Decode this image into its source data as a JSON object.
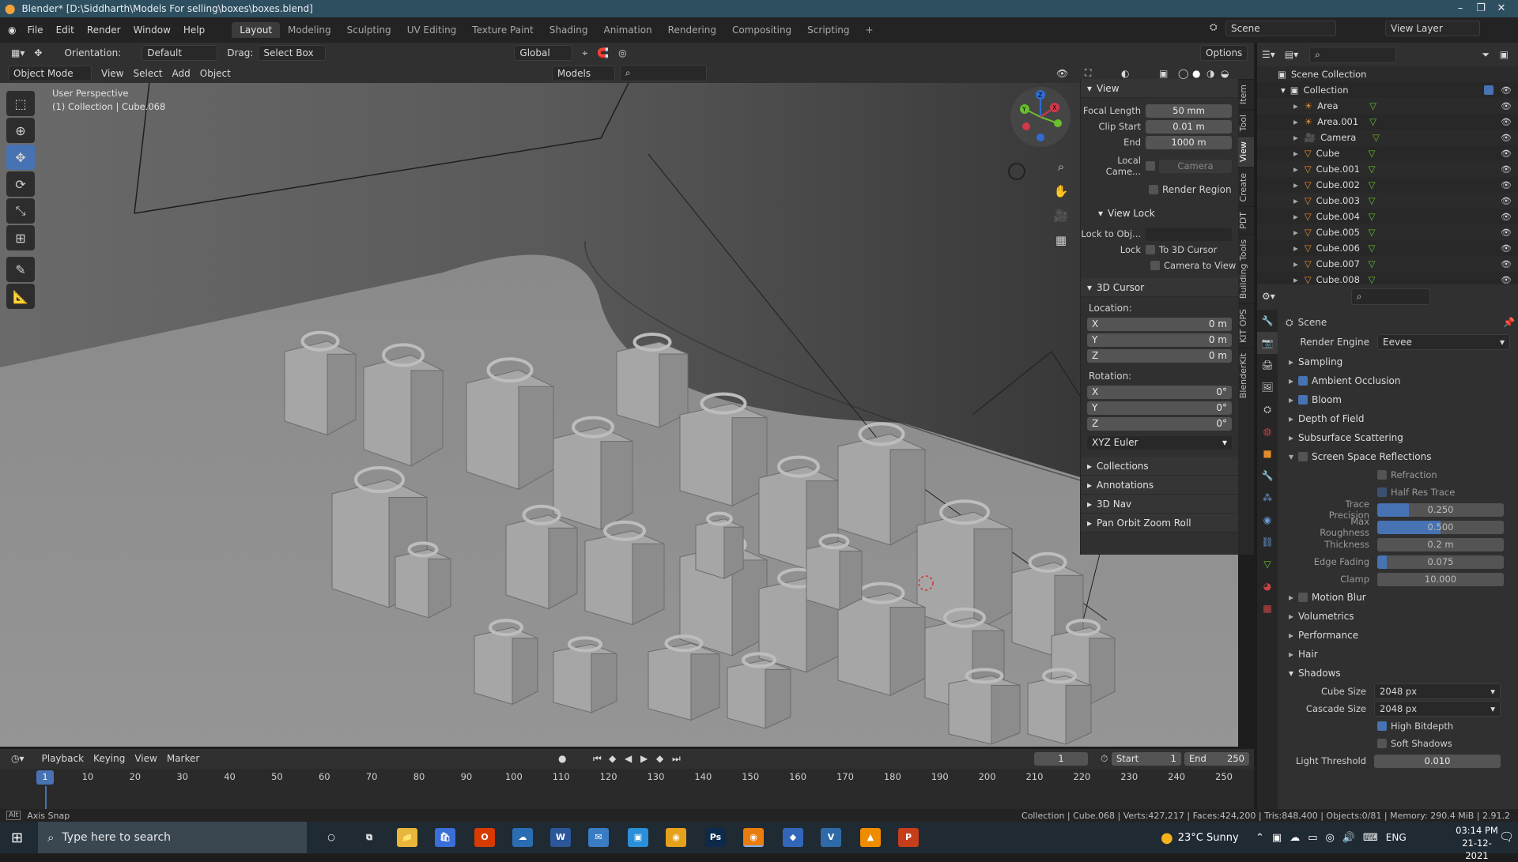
{
  "window": {
    "title": "Blender* [D:\\Siddharth\\Models For selling\\boxes\\boxes.blend]"
  },
  "menubar": {
    "items": [
      "File",
      "Edit",
      "Render",
      "Window",
      "Help"
    ]
  },
  "workspaces": [
    "Layout",
    "Modeling",
    "Sculpting",
    "UV Editing",
    "Texture Paint",
    "Shading",
    "Animation",
    "Rendering",
    "Compositing",
    "Scripting"
  ],
  "scene_field": "Scene",
  "viewlayer_field": "View Layer",
  "header": {
    "orientation_label": "Orientation:",
    "orientation_value": "Default",
    "drag_label": "Drag:",
    "drag_value": "Select Box",
    "transform": "Global",
    "options": "Options"
  },
  "header2": {
    "mode": "Object Mode",
    "view": "View",
    "select": "Select",
    "add": "Add",
    "object": "Object",
    "models": "Models"
  },
  "viewport": {
    "perspective": "User Perspective",
    "collection": "(1) Collection | Cube.068"
  },
  "npanel": {
    "view_title": "View",
    "focal_label": "Focal Length",
    "focal_value": "50 mm",
    "clip_start_label": "Clip Start",
    "clip_start_value": "0.01 m",
    "end_label": "End",
    "end_value": "1000 m",
    "local_camera_label": "Local Came...",
    "local_camera_value": "Camera",
    "render_region": "Render Region",
    "view_lock_title": "View Lock",
    "lock_obj_label": "Lock to Obj...",
    "lock_label": "Lock",
    "to_3d_cursor": "To 3D Cursor",
    "camera_to_view": "Camera to View",
    "cursor_title": "3D Cursor",
    "location_label": "Location:",
    "rotation_label": "Rotation:",
    "loc": [
      {
        "axis": "X",
        "value": "0 m"
      },
      {
        "axis": "Y",
        "value": "0 m"
      },
      {
        "axis": "Z",
        "value": "0 m"
      }
    ],
    "rot": [
      {
        "axis": "X",
        "value": "0°"
      },
      {
        "axis": "Y",
        "value": "0°"
      },
      {
        "axis": "Z",
        "value": "0°"
      }
    ],
    "euler": "XYZ Euler",
    "collapsed": [
      "Collections",
      "Annotations",
      "3D Nav",
      "Pan Orbit Zoom Roll"
    ]
  },
  "sidetabs": [
    "Item",
    "Tool",
    "View",
    "Create",
    "PDT",
    "Building Tools",
    "KIT OPS",
    "BlenderKit"
  ],
  "outliner": {
    "root": "Scene Collection",
    "collection": "Collection",
    "items": [
      "Area",
      "Area.001",
      "Camera",
      "Cube",
      "Cube.001",
      "Cube.002",
      "Cube.003",
      "Cube.004",
      "Cube.005",
      "Cube.006",
      "Cube.007",
      "Cube.008"
    ]
  },
  "props": {
    "scene": "Scene",
    "render_engine_label": "Render Engine",
    "render_engine": "Eevee",
    "sections_top": [
      {
        "label": "Sampling",
        "check": false,
        "checked": false
      },
      {
        "label": "Ambient Occlusion",
        "check": true,
        "checked": true
      },
      {
        "label": "Bloom",
        "check": true,
        "checked": true
      },
      {
        "label": "Depth of Field",
        "check": false,
        "checked": false
      },
      {
        "label": "Subsurface Scattering",
        "check": false,
        "checked": false
      },
      {
        "label": "Screen Space Reflections",
        "check": true,
        "checked": false
      }
    ],
    "refraction": "Refraction",
    "half_res": "Half Res Trace",
    "sliders": [
      {
        "label": "Trace Precision",
        "value": "0.250",
        "fill": 0.25
      },
      {
        "label": "Max Roughness",
        "value": "0.500",
        "fill": 0.5
      },
      {
        "label": "Thickness",
        "value": "0.2 m",
        "fill": 0
      },
      {
        "label": "Edge Fading",
        "value": "0.075",
        "fill": 0.075
      },
      {
        "label": "Clamp",
        "value": "10.000",
        "fill": 0
      }
    ],
    "sections_bottom": [
      {
        "label": "Motion Blur",
        "check": true,
        "checked": false
      },
      {
        "label": "Volumetrics",
        "check": false,
        "checked": false
      },
      {
        "label": "Performance",
        "check": false,
        "checked": false
      },
      {
        "label": "Hair",
        "check": false,
        "checked": false
      }
    ],
    "shadows": "Shadows",
    "cube_size_label": "Cube Size",
    "cube_size": "2048 px",
    "cascade_label": "Cascade Size",
    "cascade": "2048 px",
    "high_bitdepth": "High Bitdepth",
    "soft_shadows": "Soft Shadows",
    "light_threshold_label": "Light Threshold",
    "light_threshold": "0.010"
  },
  "timeline": {
    "playback": "Playback",
    "keying": "Keying",
    "view": "View",
    "marker": "Marker",
    "current": "1",
    "start_label": "Start",
    "start": "1",
    "end_label": "End",
    "end": "250",
    "ticks": [
      "10",
      "20",
      "30",
      "40",
      "50",
      "60",
      "70",
      "80",
      "90",
      "100",
      "110",
      "120",
      "130",
      "140",
      "150",
      "160",
      "170",
      "180",
      "190",
      "200",
      "210",
      "220",
      "230",
      "240",
      "250"
    ],
    "frame": "1"
  },
  "status": {
    "left": "Axis Snap",
    "right": "Collection | Cube.068 | Verts:427,217 | Faces:424,200 | Tris:848,400 | Objects:0/81 | Memory: 290.4 MiB | 2.91.2"
  },
  "taskbar": {
    "search": "Type here to search",
    "weather": "23°C  Sunny",
    "lang": "ENG",
    "time": "03:14 PM",
    "date": "21-12-2021"
  }
}
